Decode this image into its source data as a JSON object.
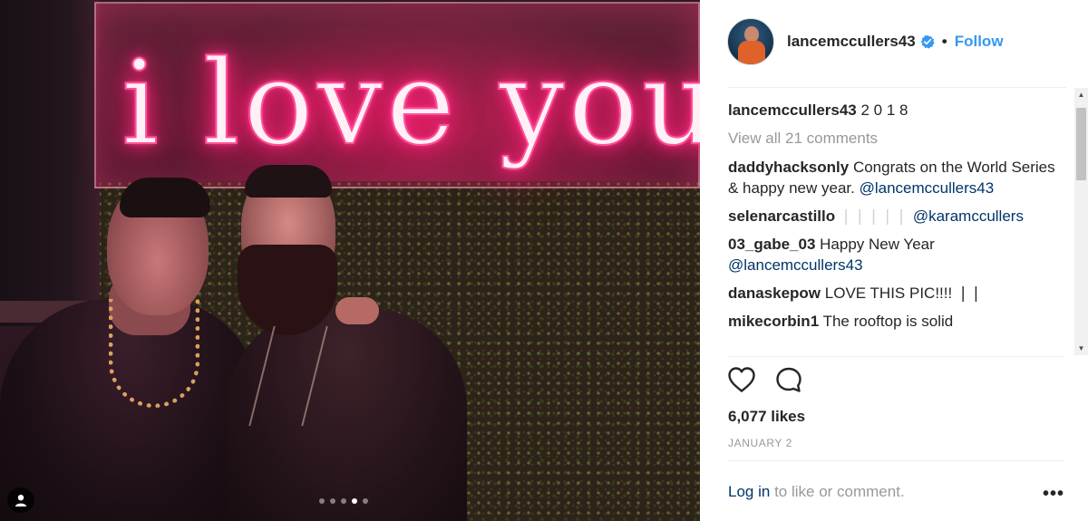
{
  "photo": {
    "sign_text": "i love you",
    "carousel": {
      "total": 5,
      "active_index": 3
    }
  },
  "post": {
    "author": "lancemccullers43",
    "verified": true,
    "separator": "•",
    "follow_label": "Follow",
    "caption": "2 0 1 8",
    "view_all_comments": "View all 21 comments",
    "comments": [
      {
        "user": "daddyhacksonly",
        "text": "Congrats on the World Series & happy new year.",
        "mention": "@lancemccullers43"
      },
      {
        "user": "selenarcastillo",
        "text": "❘❘❘❘❘",
        "mention": "@karamccullers"
      },
      {
        "user": "03_gabe_03",
        "text": "Happy New Year",
        "mention": "@lancemccullers43"
      },
      {
        "user": "danaskepow",
        "text": "LOVE THIS PIC!!!! ❘❘",
        "mention": ""
      },
      {
        "user": "mikecorbin1",
        "text": "The rooftop is solid",
        "mention": ""
      }
    ],
    "likes": "6,077 likes",
    "date": "JANUARY 2",
    "login_link": "Log in",
    "login_suffix": "to like or comment.",
    "more_label": "•••"
  },
  "icons": {
    "like": "heart-icon",
    "comment": "comment-icon",
    "verified": "verified-badge-icon",
    "tag": "user-tag-icon"
  },
  "colors": {
    "link_blue": "#3897f0",
    "mention_navy": "#003569",
    "muted_gray": "#999999",
    "neon_pink": "#ff2a7f"
  }
}
